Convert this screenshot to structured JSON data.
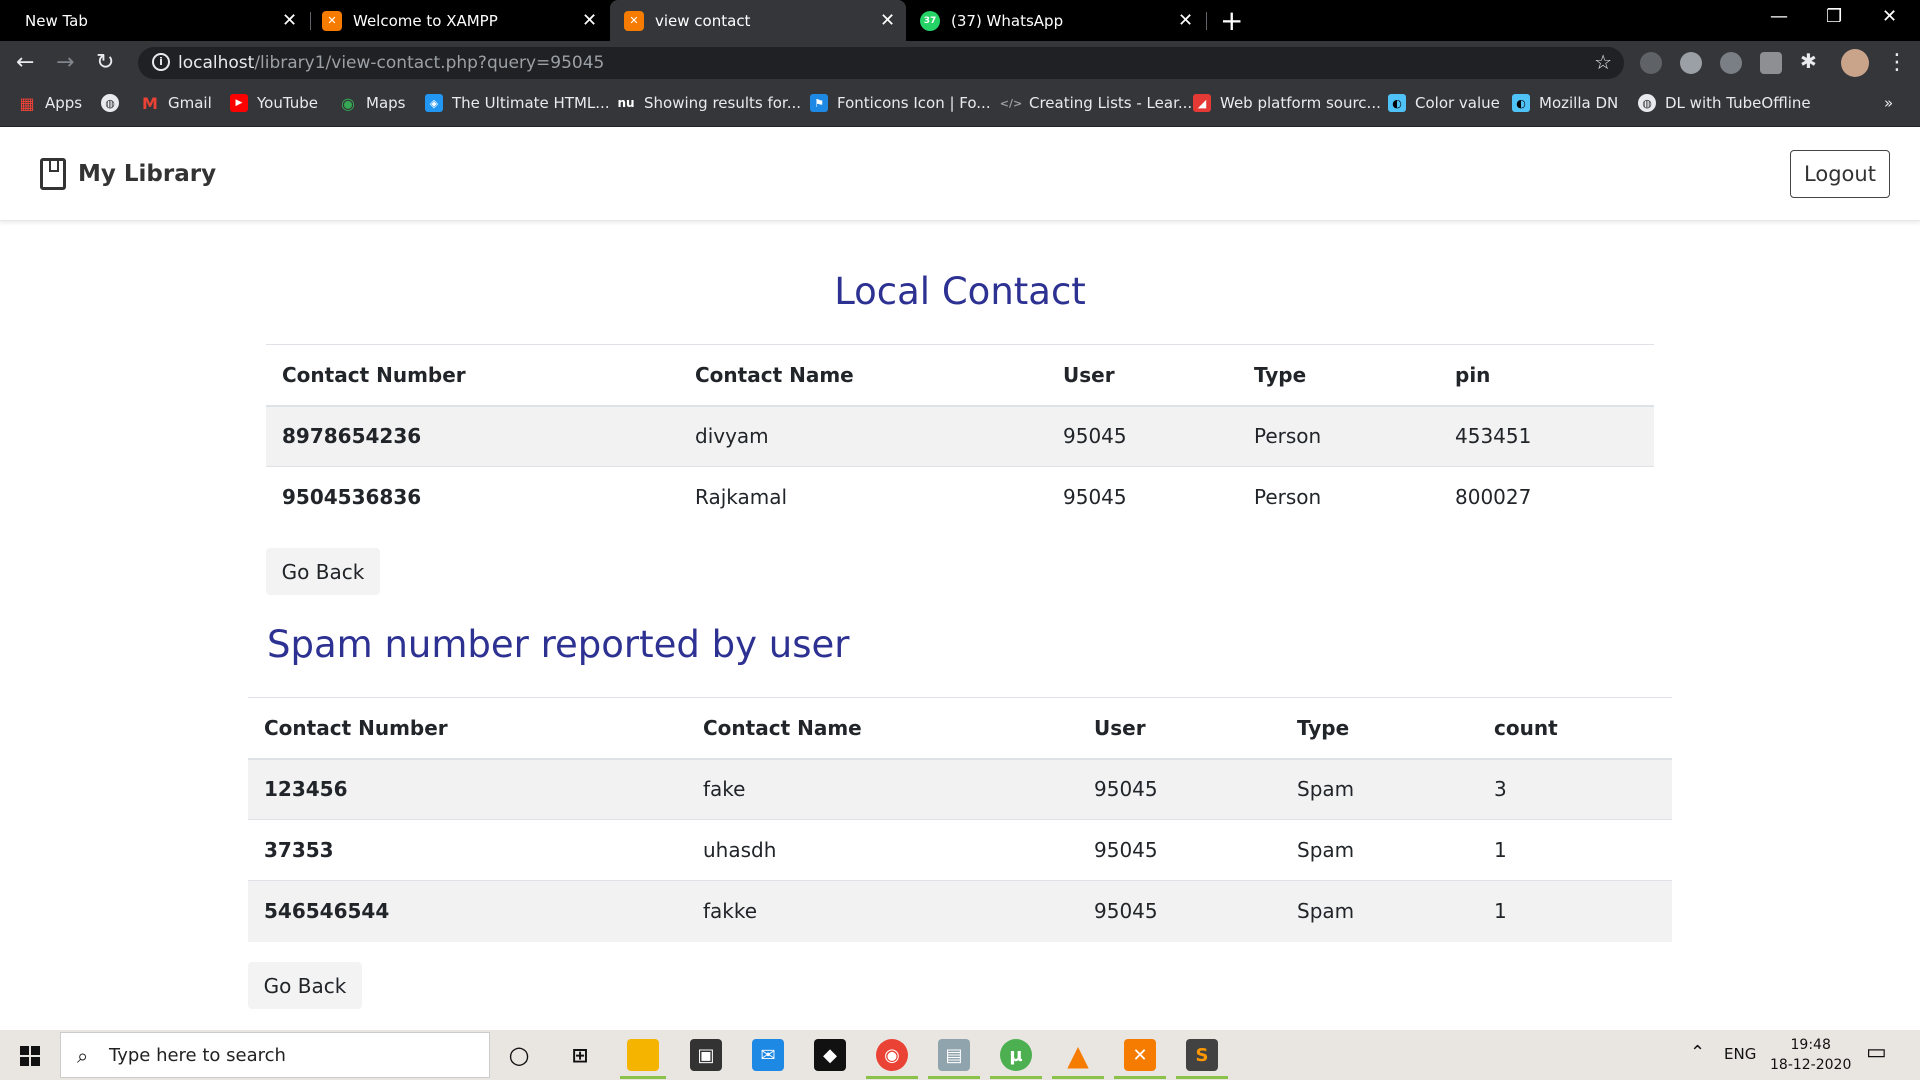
{
  "browser": {
    "tabs": [
      {
        "title": "New Tab",
        "active": false
      },
      {
        "title": "Welcome to XAMPP",
        "active": false
      },
      {
        "title": "view contact",
        "active": true
      },
      {
        "title": "(37) WhatsApp",
        "active": false
      }
    ],
    "whatsapp_badge": "37",
    "url_host": "localhost",
    "url_path": "/library1/view-contact.php?query=95045",
    "bookmarks": [
      "Apps",
      "",
      "Gmail",
      "YouTube",
      "Maps",
      "The Ultimate HTML...",
      "Showing results for...",
      "Fonticons Icon | Fo...",
      "Creating Lists - Lear...",
      "Web platform sourc...",
      "Color value",
      "Mozilla DN",
      "DL with TubeOffline"
    ],
    "more_bookmarks": "»"
  },
  "page": {
    "brand": "My Library",
    "logout_label": "Logout",
    "local_heading": "Local Contact",
    "local_columns": [
      "Contact Number",
      "Contact Name",
      "User",
      "Type",
      "pin"
    ],
    "local_rows": [
      [
        "8978654236",
        "divyam",
        "95045",
        "Person",
        "453451"
      ],
      [
        "9504536836",
        "Rajkamal",
        "95045",
        "Person",
        "800027"
      ]
    ],
    "go_back_1": "Go Back",
    "spam_heading": "Spam number reported by user",
    "spam_columns": [
      "Contact Number",
      "Contact Name",
      "User",
      "Type",
      "count"
    ],
    "spam_rows": [
      [
        "123456",
        "fake",
        "95045",
        "Spam",
        "3"
      ],
      [
        "37353",
        "uhasdh",
        "95045",
        "Spam",
        "1"
      ],
      [
        "546546544",
        "fakke",
        "95045",
        "Spam",
        "1"
      ]
    ],
    "go_back_2": "Go Back"
  },
  "taskbar": {
    "search_placeholder": "Type here to search",
    "language": "ENG",
    "time": "19:48",
    "date": "18-12-2020"
  },
  "colors": {
    "heading": "#2d3192",
    "stripe": "#f2f2f2",
    "chrome_dark": "#35363a"
  }
}
